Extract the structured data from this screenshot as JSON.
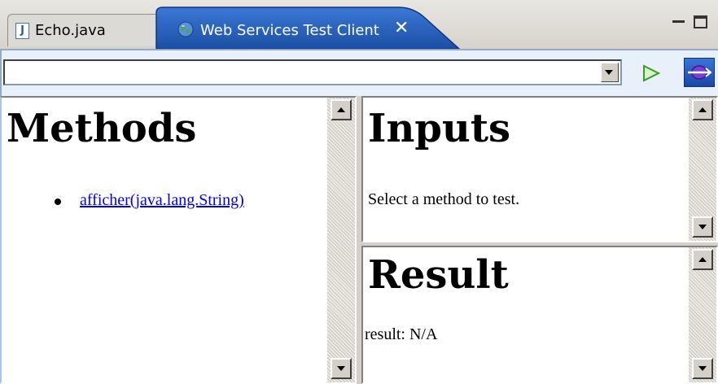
{
  "tabs": [
    {
      "label": "Echo.java",
      "icon": "java-file-icon",
      "active": false
    },
    {
      "label": "Web Services Test Client",
      "icon": "globe-icon",
      "active": true,
      "closable": true
    }
  ],
  "toolbar": {
    "address_value": "",
    "go_icon": "play-icon",
    "wsdl_icon": "wsdl-page-icon"
  },
  "methods": {
    "title": "Methods",
    "items": [
      "afficher(java.lang.String)"
    ]
  },
  "inputs": {
    "title": "Inputs",
    "message": "Select a method to test."
  },
  "result": {
    "title": "Result",
    "text": "result: N/A"
  },
  "colors": {
    "link": "#0000ee",
    "toolbar_bg": "#e8f0f9",
    "chrome_bg": "#d4d0c8",
    "active_tab": "#1f56ad"
  }
}
